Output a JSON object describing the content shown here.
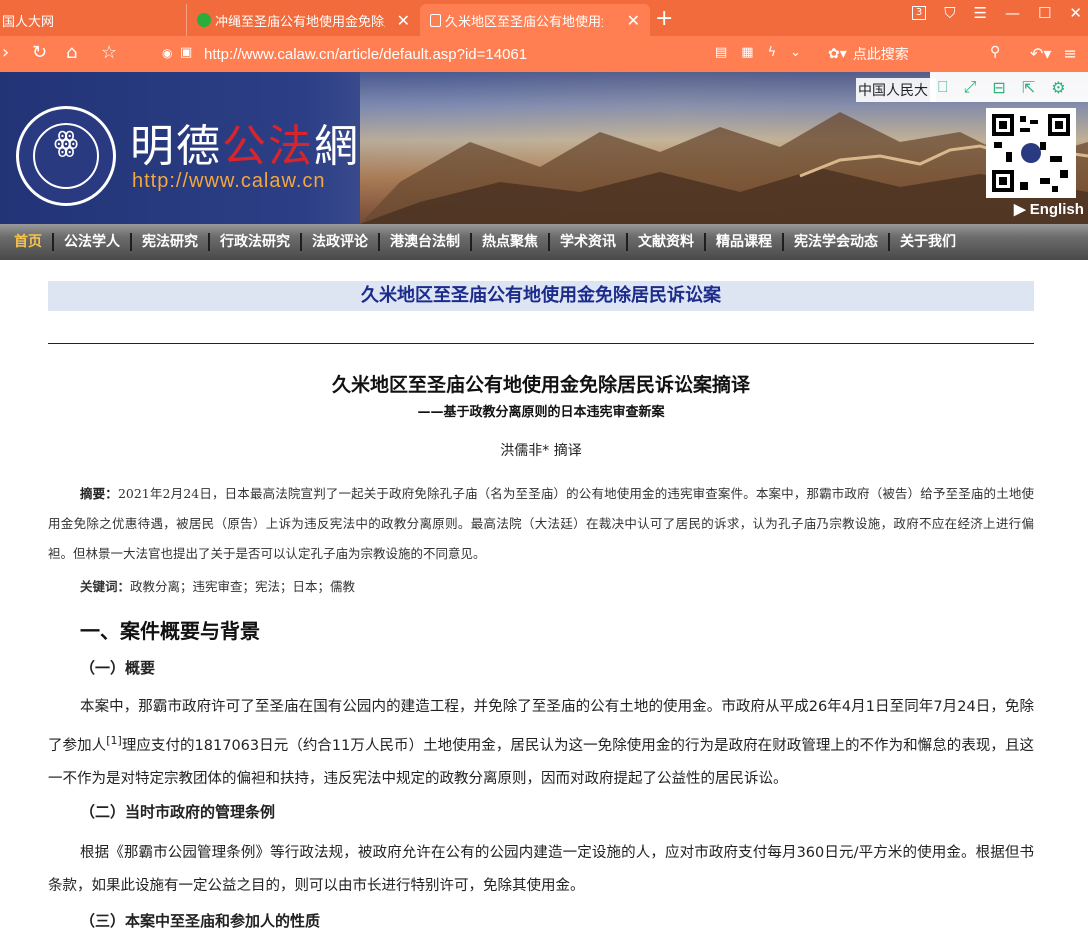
{
  "browser": {
    "tabs": [
      {
        "label": "国人大网"
      },
      {
        "label": "冲绳至圣庙公有地使用金免除居民"
      },
      {
        "label": "久米地区至圣庙公有地使用金免除"
      }
    ],
    "tab_count_badge": "3",
    "url": "http://www.calaw.cn/article/default.asp?id=14061",
    "search_placeholder": "点此搜索"
  },
  "site": {
    "logo_text_part1": "明德",
    "logo_text_part2": "公法",
    "logo_text_part3": "網",
    "url_text": "http://www.calaw.cn",
    "university_label": "中国人民大",
    "english_link": "▶ English"
  },
  "nav": {
    "items": [
      {
        "label": "首页",
        "active": true
      },
      {
        "label": "公法学人"
      },
      {
        "label": "宪法研究"
      },
      {
        "label": "行政法研究"
      },
      {
        "label": "法政评论"
      },
      {
        "label": "港澳台法制"
      },
      {
        "label": "热点聚焦"
      },
      {
        "label": "学术资讯"
      },
      {
        "label": "文献资料"
      },
      {
        "label": "精品课程"
      },
      {
        "label": "宪法学会动态"
      },
      {
        "label": "关于我们"
      }
    ]
  },
  "article": {
    "band_title": "久米地区至圣庙公有地使用金免除居民诉讼案",
    "title": "久米地区至圣庙公有地使用金免除居民诉讼案摘译",
    "subtitle": "——基于政教分离原则的日本违宪审查新案",
    "author": "洪儒非* 摘译",
    "abstract_label": "摘要：",
    "abstract_text": "2021年2月24日，日本最高法院宣判了一起关于政府免除孔子庙（名为至圣庙）的公有地使用金的违宪审查案件。本案中，那霸市政府（被告）给予至圣庙的土地使用金免除之优惠待遇，被居民（原告）上诉为违反宪法中的政教分离原则。最高法院（大法廷）在裁决中认可了居民的诉求，认为孔子庙乃宗教设施，政府不应在经济上进行偏袒。但林景一大法官也提出了关于是否可以认定孔子庙为宗教设施的不同意见。",
    "keywords_label": "关键词：",
    "keywords_text": "政教分离；违宪审查；宪法；日本；儒教",
    "section1": "一、案件概要与背景",
    "sub1": "（一）概要",
    "para1_a": "本案中，那霸市政府许可了至圣庙在国有公园内的建造工程，并免除了至圣庙的公有土地的使用金。市政府从平成26年4月1日至同年7月24日，免除了参加人",
    "para1_note": "[1]",
    "para1_b": "理应支付的1817063日元（约合11万人民币）土地使用金，居民认为这一免除使用金的行为是政府在财政管理上的不作为和懈怠的表现，且这一不作为是对特定宗教团体的偏袒和扶持，违反宪法中规定的政教分离原则，因而对政府提起了公益性的居民诉讼。",
    "sub2": "（二）当时市政府的管理条例",
    "para2": "根据《那霸市公园管理条例》等行政法规，被政府允许在公有的公园内建造一定设施的人，应对市政府支付每月360日元/平方米的使用金。根据但书条款，如果此设施有一定公益之目的，则可以由市长进行特别许可，免除其使用金。",
    "sub3": "（三）本案中至圣庙和参加人的性质"
  }
}
